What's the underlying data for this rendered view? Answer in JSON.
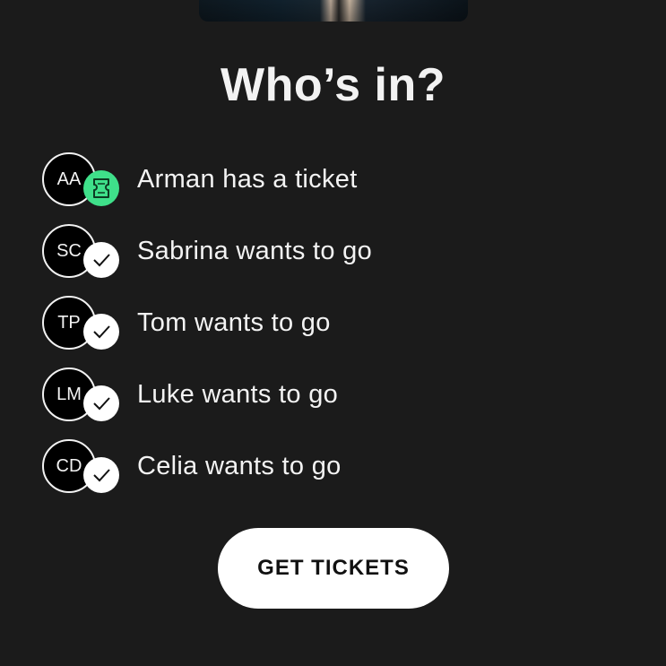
{
  "title": "Who’s in?",
  "attendees": [
    {
      "initials": "AA",
      "text": "Arman has a ticket",
      "badge": "ticket-icon"
    },
    {
      "initials": "SC",
      "text": "Sabrina wants to go",
      "badge": "check-icon"
    },
    {
      "initials": "TP",
      "text": "Tom wants to go",
      "badge": "check-icon"
    },
    {
      "initials": "LM",
      "text": "Luke wants to go",
      "badge": "check-icon"
    },
    {
      "initials": "CD",
      "text": "Celia wants to go",
      "badge": "check-icon"
    }
  ],
  "cta": {
    "label": "GET TICKETS"
  },
  "colors": {
    "background": "#1b1b1b",
    "ticket_badge": "#3fe08a",
    "check_badge": "#ffffff",
    "button": "#ffffff"
  }
}
